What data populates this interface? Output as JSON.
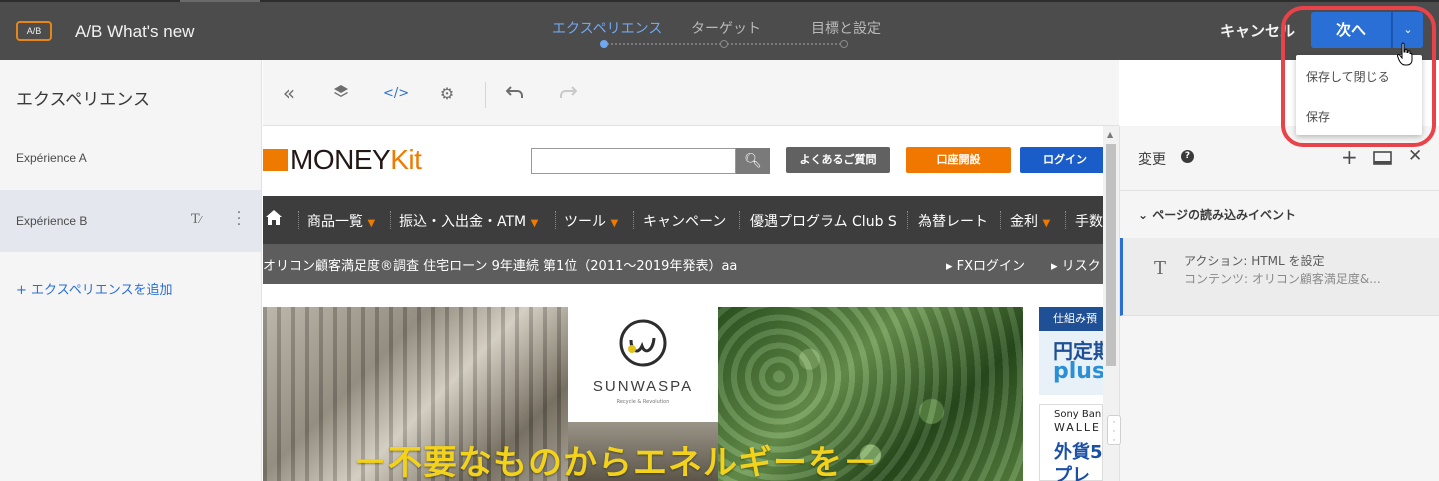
{
  "header": {
    "badge": "A/B",
    "title": "A/B What's new",
    "steps": [
      {
        "label": "エクスペリエンス",
        "active": true
      },
      {
        "label": "ターゲット",
        "active": false
      },
      {
        "label": "目標と設定",
        "active": false
      }
    ],
    "cancel_label": "キャンセル",
    "next_label": "次へ",
    "next_menu": [
      "保存して閉じる",
      "保存"
    ],
    "accent_color": "#2a6fd6",
    "callout_color": "#e8434a"
  },
  "left_panel": {
    "title": "エクスペリエンス",
    "experiences": [
      {
        "label": "Expérience A",
        "selected": false
      },
      {
        "label": "Expérience B",
        "selected": true
      }
    ],
    "add_label": "+ エクスペリエンスを追加"
  },
  "toolbar": {
    "icons": [
      "collapse-left-icon",
      "layers-icon",
      "code-icon",
      "settings-icon",
      "undo-icon",
      "redo-icon"
    ]
  },
  "preview": {
    "logo_prefix": "MONEY",
    "logo_suffix": "Kit",
    "header_buttons": [
      {
        "label": "よくあるご質問",
        "color": "#616161"
      },
      {
        "label": "口座開設",
        "color": "#f07800"
      },
      {
        "label": "ログイン",
        "color": "#1a5dc8"
      }
    ],
    "nav": [
      "商品一覧",
      "振込・入出金・ATM",
      "ツール",
      "キャンペーン",
      "優遇プログラム Club S",
      "為替レート",
      "金利",
      "手数"
    ],
    "ticker": "オリコン顧客満足度®調査 住宅ローン 9年連続 第1位（2011～2019年発表）aa",
    "ticker_links": [
      "FXログイン",
      "リスク"
    ],
    "hero_brand": "SUNWASPA",
    "hero_tagline": "Recycle & Revolution",
    "hero_slogan": "－不要なものからエネルギーを－",
    "ad_top": {
      "band": "仕組み預",
      "line1": "円定期",
      "line2": "plus"
    },
    "ad_bottom": {
      "line1": "Sony Ban",
      "line2": "WALLE",
      "line3": "外貨5",
      "line4": "プレ"
    }
  },
  "right_panel": {
    "title": "変更",
    "help": "?",
    "event_label": "ページの読み込みイベント",
    "action_title": "アクション: HTML を設定",
    "action_content": "コンテンツ: オリコン顧客満足度&..."
  }
}
